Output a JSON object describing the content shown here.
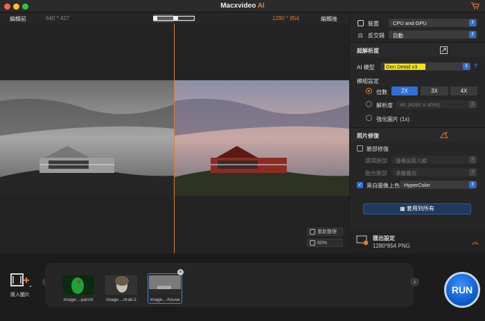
{
  "app": {
    "title": "Macxvideo ",
    "title_ai": "AI"
  },
  "colors": {
    "accent": "#e07a2a",
    "blue": "#2f6fd6",
    "highlight": "#f3e11b"
  },
  "viewer": {
    "before_label": "編輯前",
    "before_size": "640 * 427",
    "after_size": "1280 * 854",
    "after_label": "編輯後",
    "reset_label": "重新整理",
    "zoom_label": "60%"
  },
  "settings": {
    "device_label": "裝置",
    "device_value": "CPU and GPU",
    "interlace_label": "反交錯",
    "interlace_value": "自動",
    "superres_title": "超解析度",
    "ai_model_label": "AI 模型",
    "ai_model_value": "Gen Detail v3",
    "model_settings_label": "模組設定",
    "scale_label": "倍數",
    "scale_options": [
      "2X",
      "3X",
      "4X"
    ],
    "resolution_label": "解析度",
    "resolution_value": "4K (4096 X 4096)",
    "enhance_label": "強化圖片 (1x)",
    "repair_title": "照片修復",
    "face_label": "臉部修復",
    "face_model_label": "選擇臉部",
    "face_model_value": "僅專品質人臉",
    "blend_label": "融合臉部",
    "blend_value": "漸層疊加",
    "colorize_label": "黑白圖像上色",
    "colorize_value": "HyperColor",
    "apply_all_label": "套用到所有",
    "export_title": "匯出設定",
    "export_detail": "1280*854 PNG"
  },
  "bottom": {
    "import_label": "匯入圖片",
    "run_label": "RUN",
    "thumbnails": [
      {
        "label": "image...-parrot"
      },
      {
        "label": "image....rtrait-2"
      },
      {
        "label": "image...-house"
      }
    ]
  }
}
